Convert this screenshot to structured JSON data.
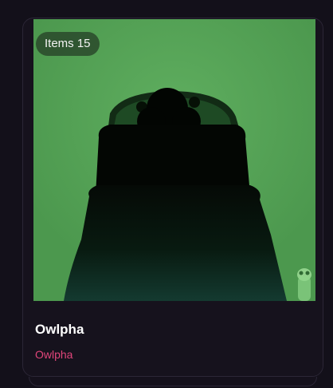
{
  "card": {
    "badge_text": "Items 15",
    "title": "Owlpha",
    "creator": "Owlpha",
    "image_icon": "owl-silhouette-artwork"
  },
  "colors": {
    "background": "#13101a",
    "card_border": "#2b2636",
    "thumbnail_green": "#4f9a52",
    "creator_pink": "#e0457a",
    "title_white": "#ffffff"
  }
}
